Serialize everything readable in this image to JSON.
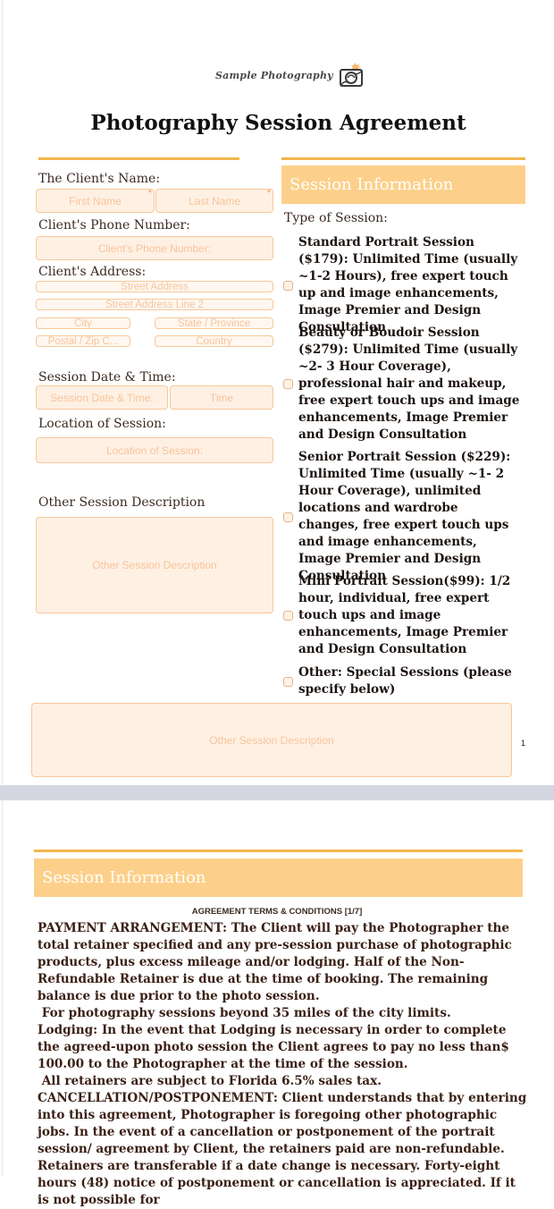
{
  "logo": {
    "text": "Sample Photography",
    "icon": "camera-logo-icon"
  },
  "title": "Photography Session Agreement",
  "client": {
    "name_label": "The Client's Name:",
    "first_name_placeholder": "First Name",
    "last_name_placeholder": "Last Name",
    "required_mark": "*",
    "phone_label": "Client's Phone Number:",
    "phone_placeholder": "Client's Phone Number:",
    "address_label": "Client's Address:",
    "street_placeholder": "Street Address",
    "street2_placeholder": "Street Address Line 2",
    "city_placeholder": "City",
    "state_placeholder": "State / Province",
    "zip_placeholder": "Postal / Zip C...",
    "country_placeholder": "Country",
    "date_label": "Session Date & Time:",
    "date_placeholder": "Session Date & Time:",
    "time_placeholder": "Time",
    "location_label": "Location of Session:",
    "location_placeholder": "Location of Session:",
    "other_desc_label": "Other Session Description",
    "other_desc_placeholder": "Other Session Description"
  },
  "session_info": {
    "heading": "Session Information",
    "type_label": "Type of Session:",
    "options": [
      {
        "label": "Standard Portrait Session ($179): Unlimited Time (usually ~1-2 Hours), free expert touch up and image enhancements, Image Premier and Design Consultation"
      },
      {
        "label": "Beauty or Boudoir Session ($279): Unlimited Time (usually ~2- 3 Hour Coverage), professional hair and makeup, free expert touch ups and image enhancements, Image Premier and Design Consultation"
      },
      {
        "label": "Senior Portrait Session ($229): Unlimited Time (usually ~1- 2 Hour Coverage), unlimited locations and wardrobe changes, free expert touch ups and image enhancements, Image Premier and Design Consultation"
      },
      {
        "label": "Mini Portrait Session($99): 1/2 hour, individual, free expert touch ups and image enhancements, Image Premier and Design Consultation"
      },
      {
        "label": "Other: Special Sessions (please specify below)"
      }
    ],
    "other_desc_placeholder": "Other Session Description"
  },
  "page_number": "1",
  "page2": {
    "heading": "Session Information",
    "terms_heading": "AGREEMENT TERMS & CONDITIONS [1/7]",
    "paragraphs": [
      "PAYMENT ARRANGEMENT: The Client will pay the Photographer the total retainer specified and any pre-session purchase of photographic products, plus excess mileage and/or lodging. Half of the Non-Refundable Retainer is due at the time of booking.  The remaining balance is due prior to the photo session.",
      " For photography sessions beyond 35 miles of the city limits.",
      "Lodging: In the event that Lodging is necessary in order to complete the agreed-upon photo session the Client agrees to pay no less than$ 100.00 to the Photographer at the time of the session.",
      " All retainers are subject to Florida 6.5% sales tax.",
      "CANCELLATION/POSTPONEMENT: Client understands that by entering into this agreement, Photographer is foregoing other photographic jobs. In the event of a cancellation or postponement of the portrait session/ agreement by Client, the retainers paid are non-refundable. Retainers are transferable if a date change is necessary. Forty-eight hours (48) notice of postponement or cancellation is appreciated. If it is not possible for"
    ]
  },
  "colors": {
    "accent": "#f2b64c",
    "header_fill": "#fcd08a",
    "field_fill": "#fff0e4",
    "field_border": "#f6c89a",
    "page_gap": "#d6d6e2"
  }
}
